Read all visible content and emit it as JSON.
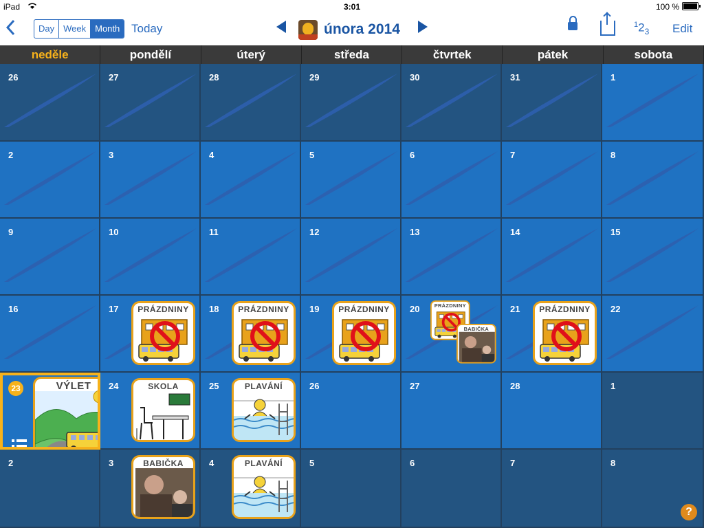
{
  "status": {
    "device": "iPad",
    "time": "3:01",
    "battery": "100 %"
  },
  "toolbar": {
    "views": [
      "Day",
      "Week",
      "Month"
    ],
    "today": "Today",
    "title": "února 2014",
    "nums_base": "1",
    "nums_mid": "2",
    "nums_sub": "3",
    "edit": "Edit"
  },
  "days": [
    "neděle",
    "pondělí",
    "úterý",
    "středa",
    "čtvrtek",
    "pátek",
    "sobota"
  ],
  "weeks": [
    [
      "26",
      "27",
      "28",
      "29",
      "30",
      "31",
      "1"
    ],
    [
      "2",
      "3",
      "4",
      "5",
      "6",
      "7",
      "8"
    ],
    [
      "9",
      "10",
      "11",
      "12",
      "13",
      "14",
      "15"
    ],
    [
      "16",
      "17",
      "18",
      "19",
      "20",
      "21",
      "22"
    ],
    [
      "23",
      "24",
      "25",
      "26",
      "27",
      "28",
      "1"
    ],
    [
      "2",
      "3",
      "4",
      "5",
      "6",
      "7",
      "8"
    ]
  ],
  "symbols": {
    "prazdniny": "PRÁZDNINY",
    "babicka": "BABIČKA",
    "vylet": "VÝLET",
    "skola": "SKOLA",
    "plavani": "PLAVÁNÍ"
  },
  "help": "?",
  "colors": {
    "accent": "#2a6bbf",
    "in_month": "#1f72c2",
    "out_month": "#235481",
    "today": "#f7b21b"
  }
}
